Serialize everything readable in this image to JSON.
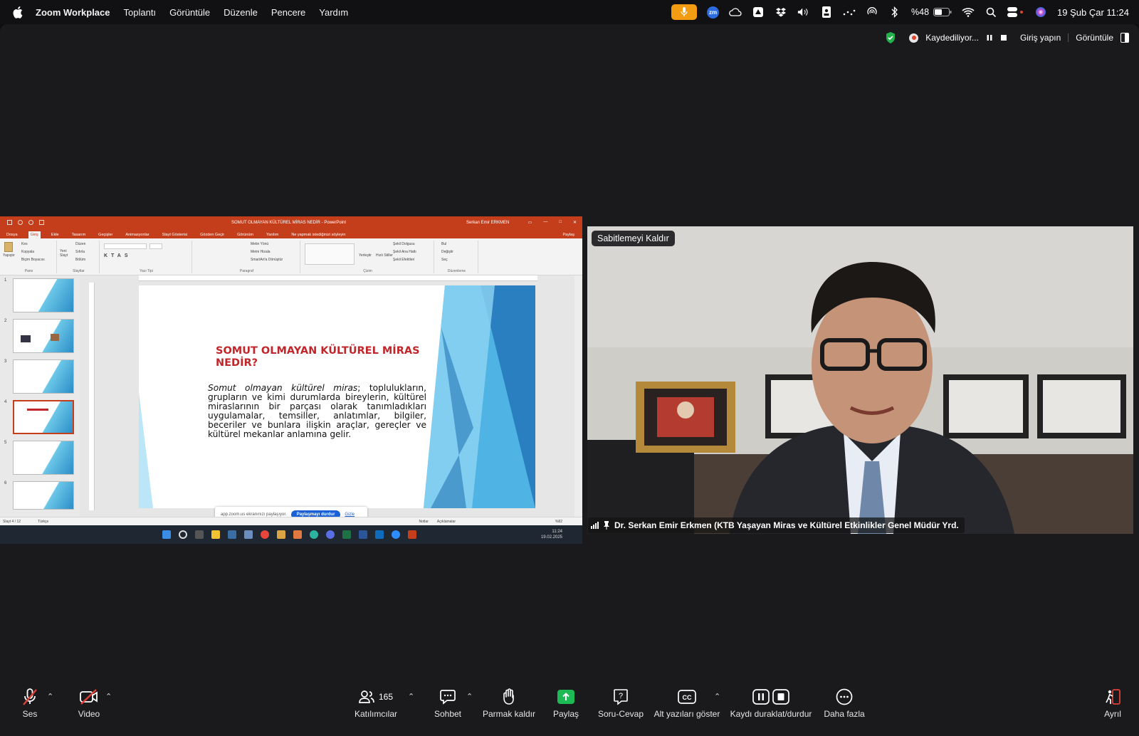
{
  "menubar": {
    "app_name": "Zoom Workplace",
    "menus": [
      "Toplantı",
      "Görüntüle",
      "Düzenle",
      "Pencere",
      "Yardım"
    ],
    "battery": "%48",
    "datetime": "19 Şub Çar  11:24",
    "zm_badge": "zm"
  },
  "meeting_status": {
    "recording_label": "Kaydediliyor...",
    "sign_in": "Giriş yapın",
    "view": "Görüntüle"
  },
  "powerpoint": {
    "window_title": "SOMUT OLMAYAN KÜLTÜREL MİRAS NEDİR - PowerPoint",
    "user": "Serkan Emir ERKMEN",
    "tabs": [
      "Dosya",
      "Giriş",
      "Ekle",
      "Tasarım",
      "Geçişler",
      "Animasyonlar",
      "Slayt Gösterisi",
      "Gözden Geçir",
      "Görünüm",
      "Yardım",
      "Ne yapmak istediğinizi söyleyin"
    ],
    "share_button": "Paylaş",
    "ribbon_groups": [
      "Pano",
      "Slaytlar",
      "Yazı Tipi",
      "Paragraf",
      "Çizim",
      "Düzenleme"
    ],
    "clipboard": {
      "paste": "Yapıştır",
      "cut": "Kes",
      "copy": "Kopyala",
      "format_painter": "Biçim Boyacısı"
    },
    "slides_group": {
      "new_slide": "Yeni Slayt",
      "layout": "Düzen",
      "reset": "Sıfırla",
      "section": "Bölüm"
    },
    "paragraph_group": {
      "text_direction": "Metin Yönü",
      "align_text": "Metni Hizala",
      "smartart": "SmartArt'a Dönüştür"
    },
    "drawing_group": {
      "arrange": "Yerleştir",
      "quick_styles": "Hızlı Stiller",
      "shape_fill": "Şekil Dolgusu",
      "shape_outline": "Şekil Ana Hattı",
      "shape_effects": "Şekil Efektleri"
    },
    "editing": {
      "find": "Bul",
      "replace": "Değiştir",
      "select": "Seç"
    },
    "slide_numbers": [
      "1",
      "2",
      "3",
      "4",
      "5",
      "6"
    ],
    "selected_slide": 4,
    "slide_title": "SOMUT OLMAYAN KÜLTÜREL MİRAS NEDİR?",
    "slide_body_italic": "Somut olmayan kültürel miras",
    "slide_body_rest": "; toplulukların, grupların ve kimi durumlarda bireylerin, kültürel miraslarının bir parçası olarak tanımladıkları uygulamalar, temsiller, anlatımlar, bilgiler, beceriler ve bunlara ilişkin araçlar, gereçler ve kültürel mekanlar anlamına gelir.",
    "statusbar": {
      "slide_of": "Slayt 4 / 12",
      "language": "Türkçe",
      "notes": "Notlar",
      "comments": "Açıklamalar",
      "zoom": "%82"
    },
    "taskbar_clock": {
      "time": "11:24",
      "date": "19.02.2025"
    }
  },
  "share_banner": {
    "text": "app.zoom.us ekranınızı paylaşıyor.",
    "stop_button": "Paylaşmayı durdur",
    "hide": "Gizle"
  },
  "video": {
    "unpin_label": "Sabitlemeyi Kaldır",
    "participant_name": "Dr. Serkan Emir Erkmen (KTB Yaşayan Miras ve Kültürel Etkinlikler Genel Müdür Yrd."
  },
  "toolbar": {
    "audio": "Ses",
    "video": "Video",
    "participants": "Katılımcılar",
    "participant_count": "165",
    "chat": "Sohbet",
    "raise_hand": "Parmak kaldır",
    "share": "Paylaş",
    "qa": "Soru-Cevap",
    "captions": "Alt yazıları göster",
    "recording": "Kaydı duraklat/durdur",
    "more": "Daha fazla",
    "leave": "Ayrıl"
  },
  "colors": {
    "ppt_red": "#c43e1c",
    "zoom_share_green": "#1db954",
    "zoom_blue": "#1a5fd6"
  }
}
